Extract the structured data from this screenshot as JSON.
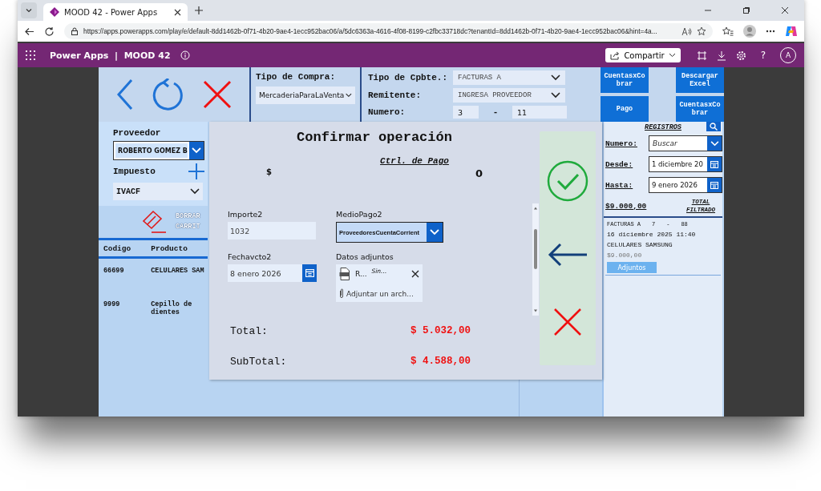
{
  "browser": {
    "tab_title": "MOOD 42 - Power Apps",
    "url": "https://apps.powerapps.com/play/e/default-8dd1462b-0f71-4b20-9ae4-1ecc952bac06/a/5dc6363a-4616-4f08-8199-c2fbc33718dc?tenantId=8dd1462b-0f71-4b20-9ae4-1ecc952bac06&hint=4a..."
  },
  "app_bar": {
    "brand": "Power Apps",
    "separator": "|",
    "app_name": "MOOD 42",
    "share_button": "Compartir",
    "help": "?",
    "avatar": "A"
  },
  "header": {
    "tipo_compra": {
      "label": "Tipo de Compra:",
      "value": "MercaderiaParaLaVenta"
    },
    "tipo_cpbte": {
      "label": "Tipo de Cpbte.:",
      "value": "FACTURAS A"
    },
    "remitente": {
      "label": "Remitente:",
      "value": "INGRESA PROVEEDOR"
    },
    "numero": {
      "label": "Numero:",
      "prefix": "3",
      "separator": "-",
      "suffix": "11"
    }
  },
  "action_buttons": [
    "CuentasxCobrar",
    "Descargar Excel",
    "Pago",
    "CuentasxCobrar"
  ],
  "left_panel": {
    "proveedor_label": "Proveedor",
    "proveedor_value": "ROBERTO GOMEZ B",
    "impuesto_label": "Impuesto",
    "impuesto_value": "IVACF",
    "clear_cart": "BORRAR CARRIT"
  },
  "cart_table": {
    "columns": [
      "Codigo",
      "Producto"
    ],
    "rows": [
      {
        "codigo": "66699",
        "producto": "CELULARES SAM"
      },
      {
        "codigo": "9999",
        "producto": "Cepillo de dientes"
      }
    ]
  },
  "modal": {
    "title": "Confirmar operación",
    "ctrl_title": "Ctrl. de Pago",
    "currency": "$",
    "ctrl_value": "0",
    "importe": {
      "label": "Importe2",
      "value": "1032"
    },
    "medio_pago": {
      "label": "MedioPago2",
      "value": "ProveedoresCuentaCorrient"
    },
    "fecha_vcto": {
      "label": "Fechavcto2",
      "value": "8 enero 2026"
    },
    "adjuntos": {
      "label": "Datos adjuntos",
      "file_name": "R...",
      "file_status": "Sin...",
      "add_link": "Adjuntar un arch..."
    },
    "total": {
      "label": "Total:",
      "value": "$ 5.032,00"
    },
    "subtotal": {
      "label": "SubTotal:",
      "value": "$ 4.588,00"
    }
  },
  "registros": {
    "title": "REGISTROS",
    "numero_label": "Numero:",
    "numero_placeholder": "Buscar",
    "desde_label": "Desde:",
    "desde_value": "1 diciembre 20",
    "hasta_label": "Hasta:",
    "hasta_value": "9 enero 2026",
    "total_value": "$9.000,00",
    "total_label": "TOTAL FILTRADO",
    "records": [
      {
        "type": "FACTURAS A",
        "prefix": "7",
        "separator": "-",
        "number": "88",
        "date": "16 diciembre 2025 11:40",
        "product": "CELULARES SAMSUNG",
        "amount": "$9.000,00",
        "attachments_button": "Adjuntos"
      }
    ]
  }
}
